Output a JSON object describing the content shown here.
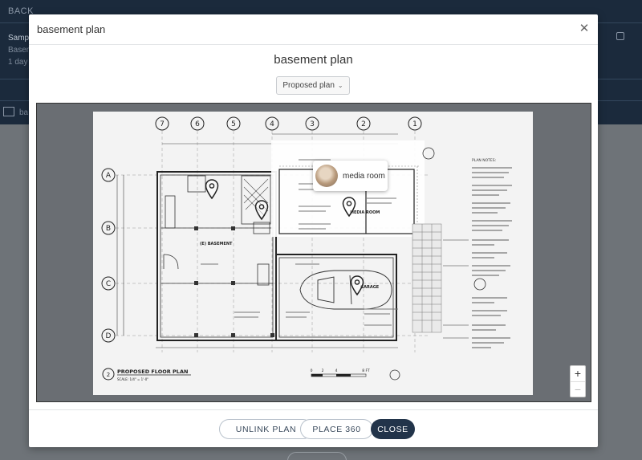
{
  "background": {
    "back_label": "BACK",
    "row1_partial": "Samp",
    "row2_partial": "Basem",
    "row3_partial": "1 day",
    "row4_partial": "ba"
  },
  "modal": {
    "title": "basement plan",
    "heading": "basement plan",
    "plan_select": {
      "selected": "Proposed plan"
    },
    "tooltip": {
      "label": "media room"
    },
    "zoom": {
      "in": "+",
      "out": "−"
    },
    "buttons": {
      "unlink": "UNLINK PLAN",
      "place360": "PLACE 360",
      "close": "CLOSE"
    }
  },
  "drawing": {
    "grid_cols": [
      "7",
      "6",
      "5",
      "4",
      "3",
      "2",
      "1"
    ],
    "grid_rows": [
      "A",
      "B",
      "C",
      "D"
    ],
    "room_basement": "(E) BASEMENT",
    "room_media": "MEDIA ROOM",
    "room_garage": "GARAGE",
    "sheet_title": "PROPOSED FLOOR PLAN",
    "sheet_num": "2",
    "scale_text": "SCALE: 1/4\" = 1'-0\"",
    "scale_marks": [
      "0",
      "2",
      "4",
      "8 FT"
    ],
    "plan_notes_title": "PLAN NOTES:"
  },
  "colors": {
    "nav_bg": "#1b2a3c",
    "primary": "#22344a",
    "overlay": "#6e7378"
  },
  "icons": {
    "close": "close-icon",
    "chevron": "chevron-down-icon",
    "marker": "map-pin-icon",
    "edit": "edit-icon",
    "grid": "grid-icon"
  }
}
